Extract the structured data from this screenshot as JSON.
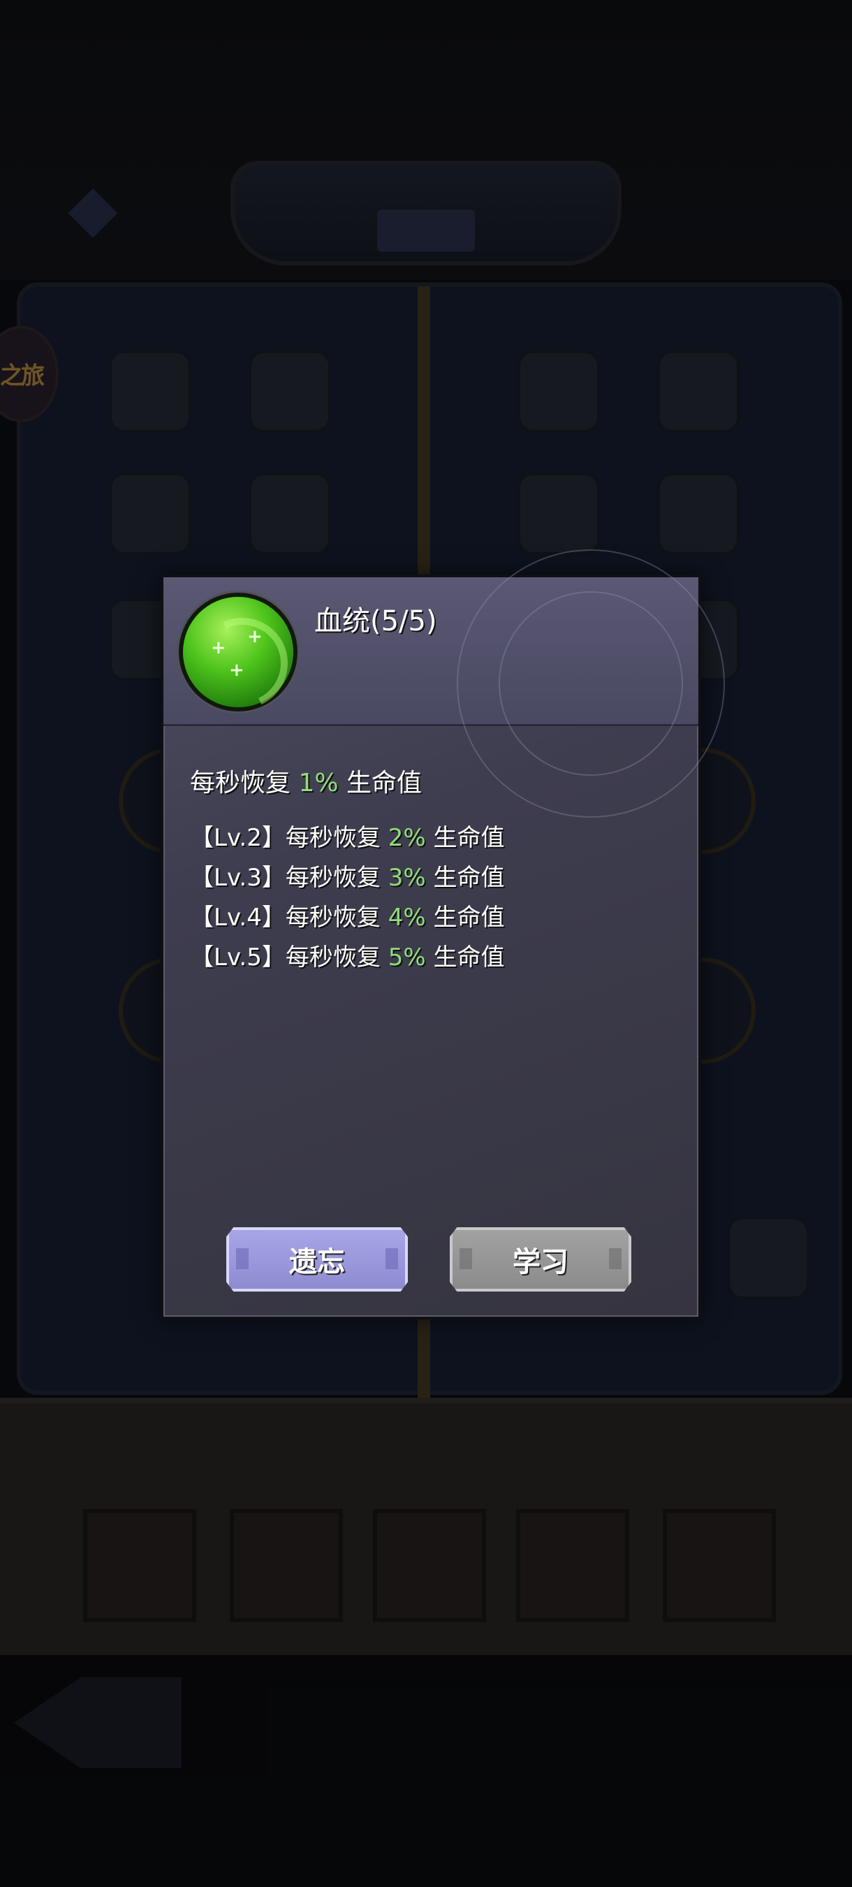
{
  "background": {
    "logo_text": "之旅"
  },
  "dialog": {
    "title": "血统(5/5)",
    "description": {
      "prefix": "每秒恢复 ",
      "value": "1%",
      "suffix": " 生命值"
    },
    "levels": [
      {
        "tag": "【Lv.2】",
        "prefix": "每秒恢复 ",
        "value": "2%",
        "suffix": " 生命值"
      },
      {
        "tag": "【Lv.3】",
        "prefix": "每秒恢复 ",
        "value": "3%",
        "suffix": " 生命值"
      },
      {
        "tag": "【Lv.4】",
        "prefix": "每秒恢复 ",
        "value": "4%",
        "suffix": " 生命值"
      },
      {
        "tag": "【Lv.5】",
        "prefix": "每秒恢复 ",
        "value": "5%",
        "suffix": " 生命值"
      }
    ],
    "buttons": {
      "forget_label": "遗忘",
      "learn_label": "学习"
    },
    "icon": "green-regeneration-orb-icon"
  },
  "colors": {
    "highlight_green": "#8fdc7a",
    "forget_button": "#9c99de",
    "learn_button": "#979797"
  }
}
